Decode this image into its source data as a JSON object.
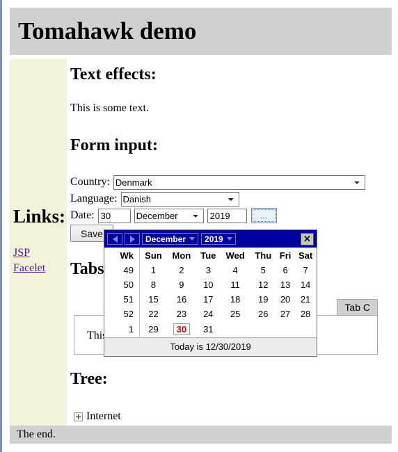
{
  "header": {
    "title": "Tomahawk demo"
  },
  "sidebar": {
    "heading": "Links:",
    "links": [
      {
        "label": "JSP"
      },
      {
        "label": "Facelet"
      }
    ]
  },
  "main": {
    "sections": {
      "text_effects": "Text effects:",
      "form_input": "Form input:",
      "tabs": "Tabs:",
      "tree": "Tree:"
    },
    "plain_text": "This is some text.",
    "form": {
      "country_label": "Country:",
      "country_value": "Denmark",
      "country_options": [
        "Denmark"
      ],
      "language_label": "Language:",
      "language_value": "Danish",
      "language_options": [
        "Danish"
      ],
      "date_label": "Date:",
      "day_value": "30",
      "month_value": "December",
      "month_options": [
        "December"
      ],
      "year_value": "2019",
      "picker_button_label": "...",
      "save_button_label": "Save"
    },
    "tabs": {
      "tab_c_label": "Tab C",
      "panel_text": "This is some text about the tab."
    },
    "tree": {
      "toggle_icon": "plus-box-icon",
      "node_label": "Internet"
    }
  },
  "calendar": {
    "prev_icon": "arrow-left-icon",
    "next_icon": "arrow-right-icon",
    "month": "December",
    "year": "2019",
    "close_icon": "close-icon",
    "close_glyph": "✕",
    "headers": [
      "Wk",
      "Sun",
      "Mon",
      "Tue",
      "Wed",
      "Thu",
      "Fri",
      "Sat"
    ],
    "weeks": [
      {
        "wk": "49",
        "days": [
          "1",
          "2",
          "3",
          "4",
          "5",
          "6",
          "7"
        ]
      },
      {
        "wk": "50",
        "days": [
          "8",
          "9",
          "10",
          "11",
          "12",
          "13",
          "14"
        ]
      },
      {
        "wk": "51",
        "days": [
          "15",
          "16",
          "17",
          "18",
          "19",
          "20",
          "21"
        ]
      },
      {
        "wk": "52",
        "days": [
          "22",
          "23",
          "24",
          "25",
          "26",
          "27",
          "28"
        ]
      },
      {
        "wk": "1",
        "days": [
          "29",
          "30",
          "31",
          "",
          "",
          "",
          ""
        ]
      }
    ],
    "today_day": "30",
    "footer_text": "Today is 12/30/2019",
    "colors": {
      "header_bg": "#00009c",
      "today_red": "#e00000",
      "sunday_gray": "#999999"
    }
  },
  "footer": {
    "text": "The end."
  }
}
